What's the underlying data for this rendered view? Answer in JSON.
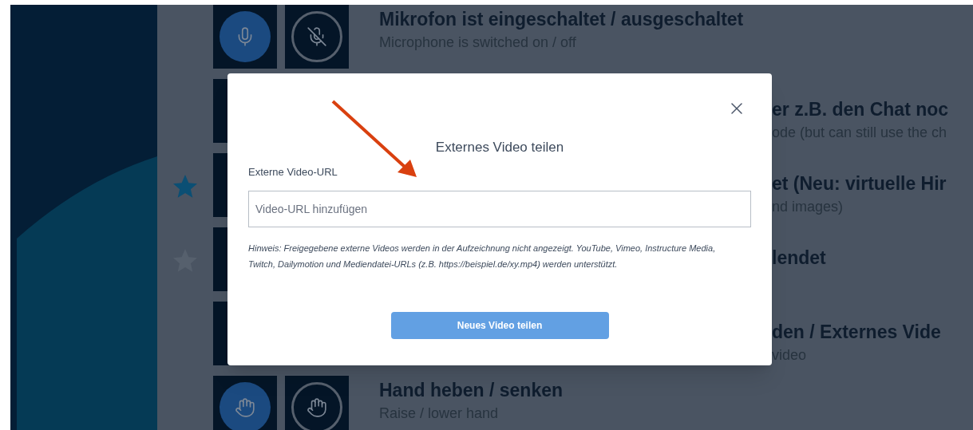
{
  "rows": [
    {
      "kind": "microphone",
      "title": "Mikrofon ist eingeschaltet / ausgeschaltet",
      "subtitle": "Microphone is switched on / off"
    },
    {
      "kind": "partial",
      "title": "er z.B. den Chat noc",
      "subtitle": "ode (but can still use the ch"
    },
    {
      "kind": "partial",
      "favorite": true,
      "title": "et (Neu: virtuelle Hir",
      "subtitle": "nd images)"
    },
    {
      "kind": "partial",
      "favorite": false,
      "title": "lendet"
    },
    {
      "kind": "partial",
      "title": "den / Externes Vide",
      "subtitle": "video"
    },
    {
      "kind": "hand",
      "title": "Hand heben / senken",
      "subtitle": "Raise / lower hand"
    }
  ],
  "dialog": {
    "title": "Externes Video teilen",
    "label": "Externe Video-URL",
    "placeholder": "Video-URL hinzufügen",
    "hint": "Hinweis: Freigegebene externe Videos werden in der Aufzeichnung nicht angezeigt. YouTube, Vimeo, Instructure Media, Twitch, Dailymotion und Mediendatei-URLs (z.B. https://beispiel.de/xy.mp4) werden unterstützt.",
    "button": "Neues Video teilen"
  }
}
